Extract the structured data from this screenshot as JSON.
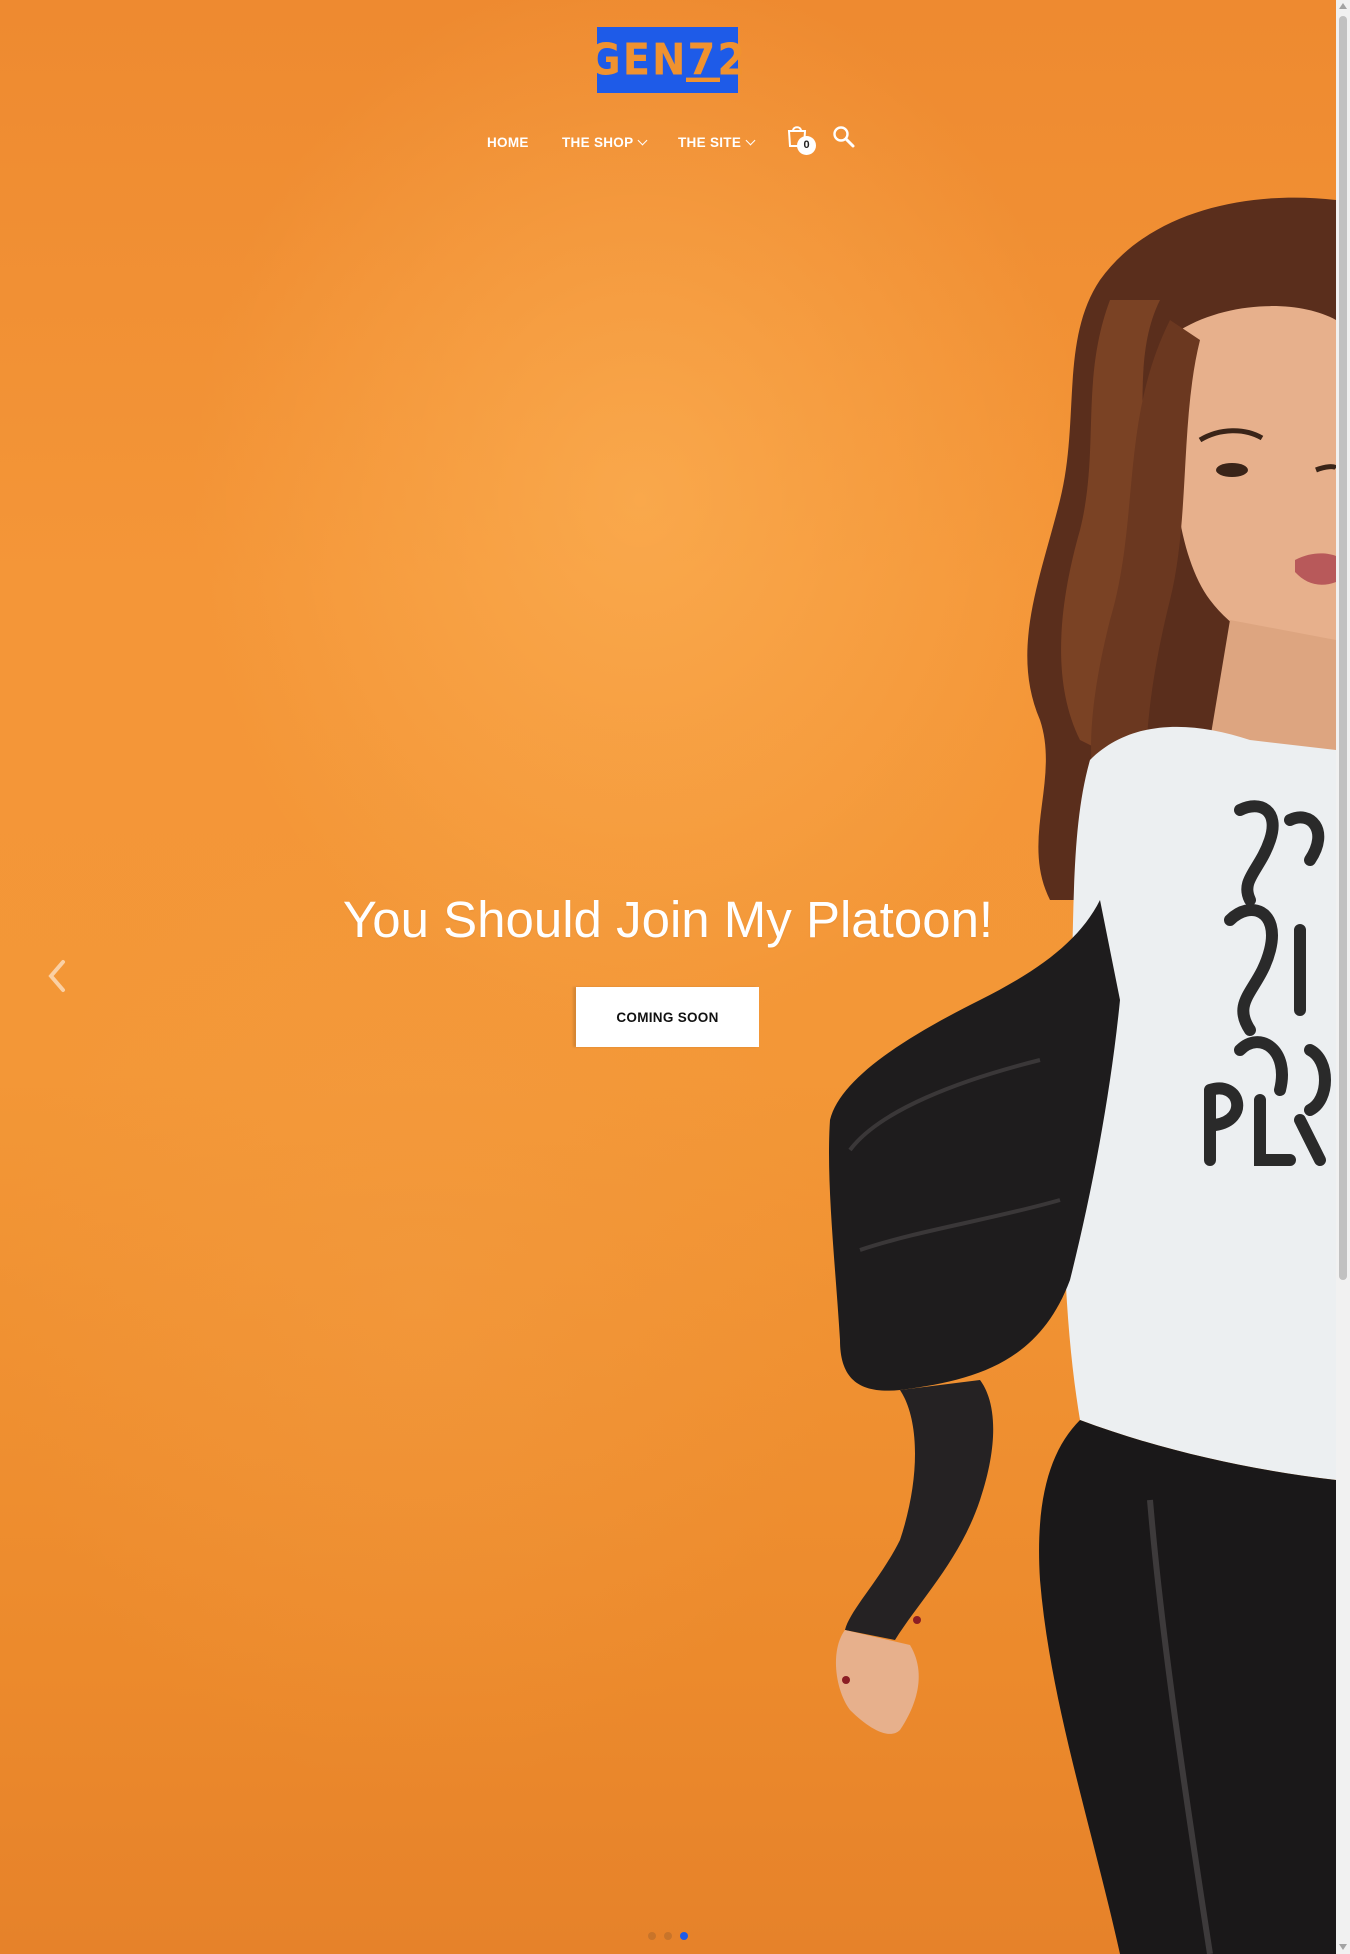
{
  "logo": {
    "text": "GEN72"
  },
  "nav": {
    "items": [
      {
        "label": "HOME",
        "has_dropdown": false
      },
      {
        "label": "THE SHOP",
        "has_dropdown": true
      },
      {
        "label": "THE SITE",
        "has_dropdown": true
      }
    ],
    "cart_count": "0",
    "cart_icon": "shopping-bag-icon",
    "search_icon": "search-icon"
  },
  "hero": {
    "headline": "You Should Join My Platoon!",
    "cta_label": "COMING SOON",
    "prev_icon": "chevron-left-icon",
    "slides": {
      "count": 3,
      "active_index": 2
    }
  },
  "colors": {
    "background": "#F0922F",
    "logo_bg": "#1E5BE8",
    "active_dot": "#1E5BE8",
    "inactive_dot": "#C8742A"
  }
}
